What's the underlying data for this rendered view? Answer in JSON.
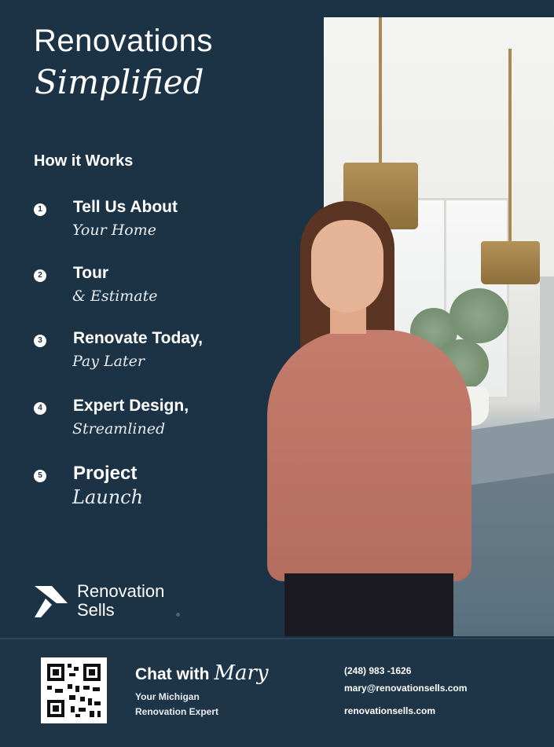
{
  "heading": {
    "line1": "Renovations",
    "line2": "Simplified"
  },
  "how_it_works": {
    "label": "How it Works",
    "steps": [
      {
        "num": "1",
        "title": "Tell Us About",
        "subtitle": "Your Home"
      },
      {
        "num": "2",
        "title": "Tour",
        "subtitle": "& Estimate"
      },
      {
        "num": "3",
        "title": "Renovate Today,",
        "subtitle": "Pay Later"
      },
      {
        "num": "4",
        "title": "Expert Design,",
        "subtitle": "Streamlined"
      },
      {
        "num": "5",
        "title": "Project",
        "subtitle": "Launch"
      }
    ]
  },
  "brand": {
    "line1": "Renovation",
    "line2": "Sells"
  },
  "footer": {
    "chat_prefix": "Chat with",
    "chat_name": "Mary",
    "role_line1": "Your Michigan",
    "role_line2": "Renovation Expert",
    "phone": "(248) 983 -1626",
    "email": "mary@renovationsells.com",
    "website": "renovationsells.com"
  },
  "colors": {
    "background": "#1c3245",
    "text": "#ffffff",
    "accent": "#c47c6c"
  }
}
